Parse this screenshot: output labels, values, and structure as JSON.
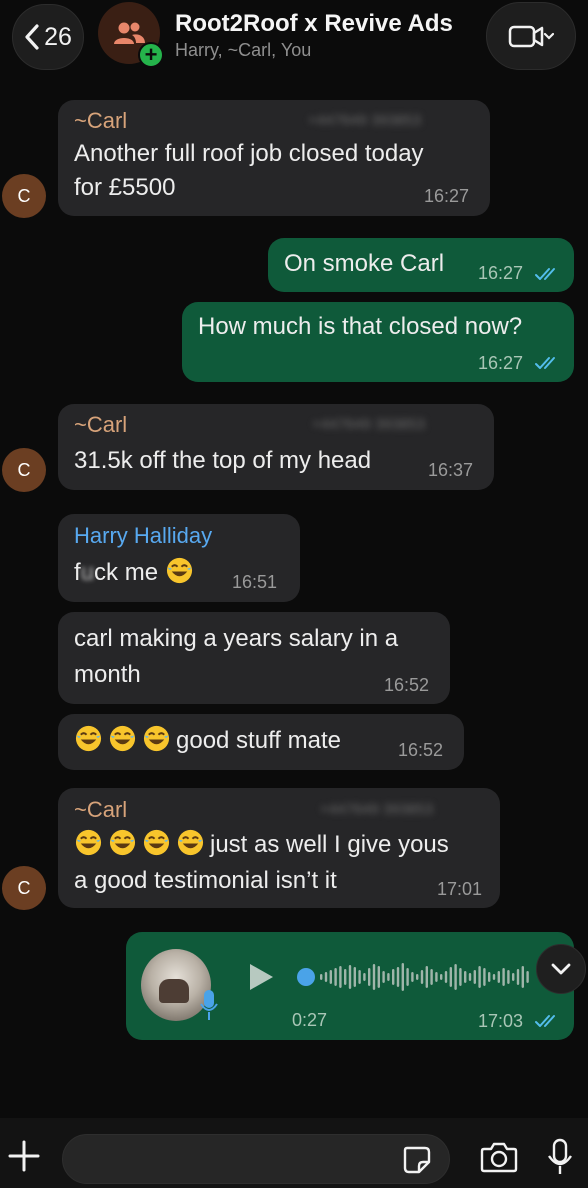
{
  "header": {
    "back_count": "26",
    "title": "Root2Roof x Revive Ads",
    "members": "Harry, ~Carl, You"
  },
  "colors": {
    "background": "#0b0b0b",
    "incoming_bubble": "#262628",
    "outgoing_bubble": "#0f5a3a",
    "carl_name": "#d7a37a",
    "harry_name": "#58a9f0",
    "read_ticks": "#53bdeb",
    "add_badge": "#25b34b"
  },
  "icons": {
    "back": "chevron-left-icon",
    "group": "group-people-icon",
    "add": "plus-icon",
    "video": "video-camera-icon",
    "read": "double-check-icon",
    "play": "play-icon",
    "scroll": "chevron-down-icon",
    "composer_add": "plus-icon",
    "sticker": "sticker-icon",
    "camera": "camera-icon",
    "mic": "microphone-icon"
  },
  "messages": [
    {
      "sender": "~Carl",
      "phone": "+447649 393853",
      "line1": "Another full roof job closed today",
      "line2": "for £5500",
      "time": "16:27"
    },
    {
      "text": "On smoke Carl",
      "time": "16:27"
    },
    {
      "text": "How much is that closed now?",
      "time": "16:27"
    },
    {
      "sender": "~Carl",
      "phone": "+447649 393853",
      "text": "31.5k off the top of my head",
      "time": "16:37"
    },
    {
      "sender": "Harry Halliday",
      "text_a": "f",
      "text_blur": "u",
      "text_b": "ck me",
      "time": "16:51"
    },
    {
      "line1": "carl making a years salary in a",
      "line2": "month",
      "time": "16:52"
    },
    {
      "text": "good stuff mate",
      "time": "16:52"
    },
    {
      "sender": "~Carl",
      "phone": "+447649 393853",
      "line1": "just as well I give yous",
      "line2": "a good testimonial isn’t it",
      "time": "17:01"
    },
    {
      "duration": "0:27",
      "time": "17:03",
      "progress": 0
    }
  ],
  "avatar_initial": "C"
}
